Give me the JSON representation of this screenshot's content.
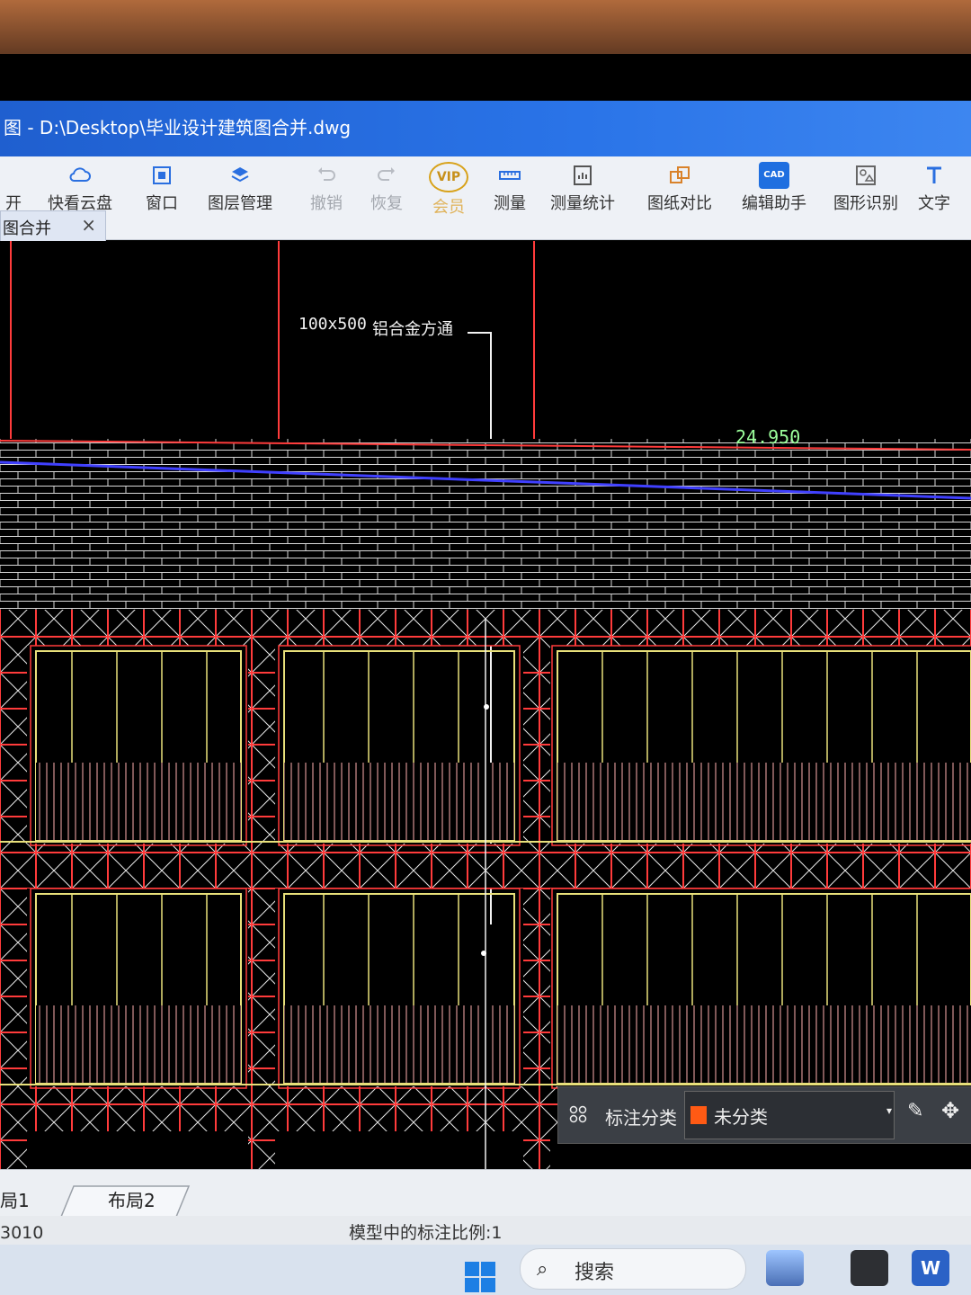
{
  "window": {
    "title": "图 - D:\\Desktop\\毕业设计建筑图合并.dwg"
  },
  "ribbon": {
    "tools": [
      {
        "label": "开",
        "icon": "open-icon",
        "enabled": true
      },
      {
        "label": "快看云盘",
        "icon": "cloud-icon",
        "enabled": true
      },
      {
        "label": "窗口",
        "icon": "window-icon",
        "enabled": true
      },
      {
        "label": "图层管理",
        "icon": "layers-icon",
        "enabled": true
      },
      {
        "label": "撤销",
        "icon": "undo-icon",
        "enabled": false
      },
      {
        "label": "恢复",
        "icon": "redo-icon",
        "enabled": false
      },
      {
        "label": "会员",
        "icon": "vip-icon",
        "badge": "VIP",
        "enabled": false
      },
      {
        "label": "测量",
        "icon": "measure-icon",
        "enabled": true
      },
      {
        "label": "测量统计",
        "icon": "measure-stats-icon",
        "enabled": true
      },
      {
        "label": "图纸对比",
        "icon": "compare-icon",
        "enabled": true
      },
      {
        "label": "编辑助手",
        "icon": "edit-assistant-icon",
        "badge": "CAD",
        "enabled": true
      },
      {
        "label": "图形识别",
        "icon": "shape-recognition-icon",
        "enabled": true
      },
      {
        "label": "文字",
        "icon": "text-icon",
        "enabled": true
      }
    ]
  },
  "document_tab": {
    "label": "图合并",
    "close": "×"
  },
  "canvas": {
    "annotation_size": "100x500",
    "annotation_material": "铝合金方通",
    "elevation": "24.950",
    "colors": {
      "background": "#000000",
      "wall": "#ff3b3b",
      "window_frame": "#e8e07a",
      "axis": "#4040ff",
      "brick": "#d8d8d8"
    }
  },
  "annotation_toolbar": {
    "category_label": "标注分类",
    "selected_value": "未分类",
    "swatch_color": "#ff5a14",
    "dropdown": "▾",
    "edit": "✎",
    "move": "✥"
  },
  "layout_tabs": [
    "局1",
    "布局2"
  ],
  "status_bar": {
    "coordinate": "3010",
    "scale_text": "模型中的标注比例:1"
  },
  "taskbar": {
    "search_label": "搜索",
    "search_icon": "⌕"
  }
}
